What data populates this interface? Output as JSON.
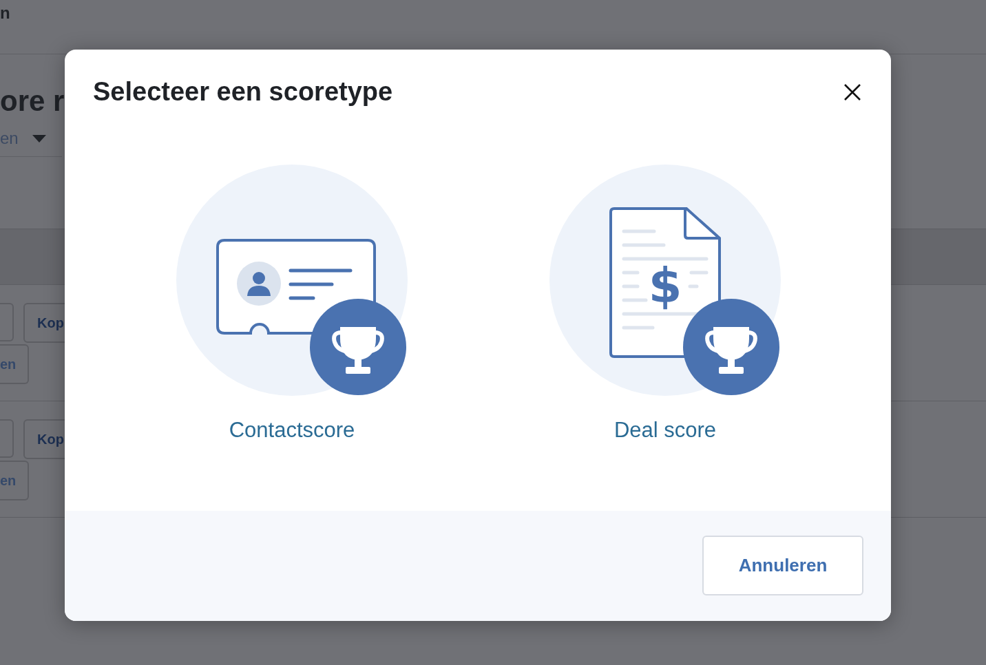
{
  "background_page": {
    "header_text": "n",
    "title": "ore r",
    "filter_label": "en",
    "rows": [
      {
        "copy_button": "Kop",
        "second_button": "en"
      },
      {
        "copy_button": "Kop",
        "second_button": "en"
      }
    ]
  },
  "dialog": {
    "title": "Selecteer een scoretype",
    "options": [
      {
        "label": "Contactscore",
        "kind": "contact"
      },
      {
        "label": "Deal score",
        "kind": "deal",
        "symbol": "$"
      }
    ],
    "cancel_button": "Annuleren"
  }
}
